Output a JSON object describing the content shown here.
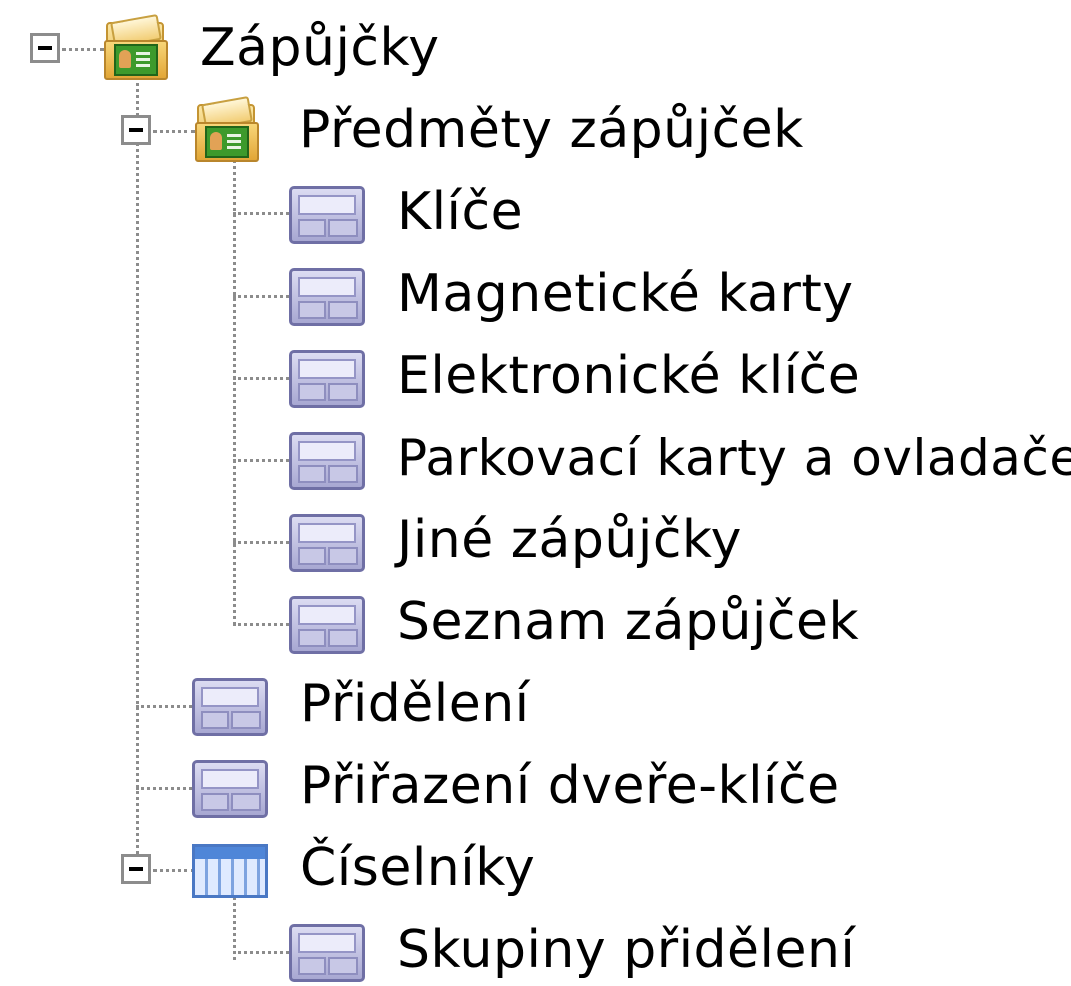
{
  "tree": {
    "root": {
      "label": "Zápůjčky",
      "icon": "folder-contacts-icon",
      "expanded": true,
      "children": {
        "predmety": {
          "label": "Předměty zápůjček",
          "icon": "folder-contacts-icon",
          "expanded": true,
          "items": [
            {
              "label": "Klíče",
              "icon": "form-icon"
            },
            {
              "label": "Magnetické karty",
              "icon": "form-icon"
            },
            {
              "label": "Elektronické klíče",
              "icon": "form-icon"
            },
            {
              "label": "Parkovací karty a ovladače",
              "icon": "form-icon"
            },
            {
              "label": "Jiné zápůjčky",
              "icon": "form-icon"
            },
            {
              "label": "Seznam zápůjček",
              "icon": "form-icon"
            }
          ]
        },
        "prideleni": {
          "label": "Přidělení",
          "icon": "form-icon"
        },
        "prirazeni": {
          "label": "Přiřazení dveře-klíče",
          "icon": "form-icon"
        },
        "ciselniky": {
          "label": "Číselníky",
          "icon": "grid-icon",
          "expanded": true,
          "items": [
            {
              "label": "Skupiny přidělení",
              "icon": "form-icon"
            }
          ]
        }
      }
    }
  },
  "colors": {
    "connector": "#8c8c8c",
    "text": "#000000",
    "background": "#ffffff"
  }
}
